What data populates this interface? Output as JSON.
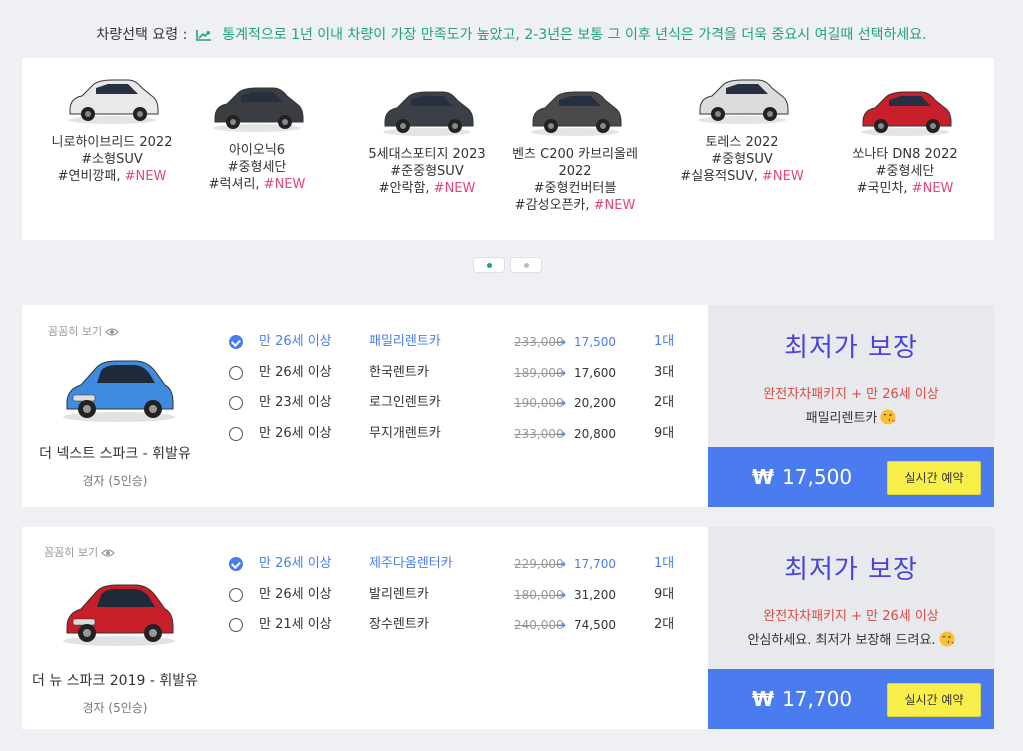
{
  "tip": {
    "label": "차량선택 요령 :",
    "icon": "trending-up-icon",
    "text": "통계적으로 1년 이내 차량이 가장 만족도가 높았고, 2-3년은 보통 그 이후 년식은 가격을 더욱 중요시 여길때 선택하세요."
  },
  "carousel": {
    "cars": [
      {
        "name": "니로하이브리드 2022",
        "segment": "#소형SUV",
        "tag": "#연비깡패,",
        "new": "#NEW",
        "color": "#e9e9e9"
      },
      {
        "name": "아이오닉6",
        "segment": "#중형세단",
        "tag": "#럭셔리,",
        "new": "#NEW",
        "color": "#3a3d42"
      },
      {
        "name": "5세대스포티지 2023",
        "segment": "#준중형SUV",
        "tag": "#안락함,",
        "new": "#NEW",
        "color": "#3b3f48"
      },
      {
        "name": "벤츠 C200 카브리올레 2022",
        "segment": "#중형컨버터블",
        "tag": "#감성오픈카,",
        "new": "#NEW",
        "color": "#4a4a4a"
      },
      {
        "name": "토레스 2022",
        "segment": "#중형SUV",
        "tag": "#실용적SUV,",
        "new": "#NEW",
        "color": "#dcdcdc"
      },
      {
        "name": "쏘나타 DN8 2022",
        "segment": "#중형세단",
        "tag": "#국민차,",
        "new": "#NEW",
        "color": "#c8202a"
      }
    ],
    "page_count": 2,
    "active_page": 1
  },
  "listings": [
    {
      "peek_label": "꼼꼼히 보기",
      "title": "더 넥스트 스파크 - 휘발유",
      "subtitle": "경자 (5인승)",
      "car_color": "#3f8be0",
      "offers": [
        {
          "age": "만 26세 이상",
          "company": "패밀리렌트카",
          "old_price": "233,000",
          "new_price": "17,500",
          "count": "1대",
          "selected": true
        },
        {
          "age": "만 26세 이상",
          "company": "한국렌트카",
          "old_price": "189,000",
          "new_price": "17,600",
          "count": "3대",
          "selected": false
        },
        {
          "age": "만 23세 이상",
          "company": "로그인렌트카",
          "old_price": "190,000",
          "new_price": "20,200",
          "count": "2대",
          "selected": false
        },
        {
          "age": "만 26세 이상",
          "company": "무지개렌트카",
          "old_price": "233,000",
          "new_price": "20,800",
          "count": "9대",
          "selected": false
        }
      ],
      "best_label": "최저가 보장",
      "package": "완전자차패키지 + 만 26세 이상",
      "message": "패밀리렌트카",
      "price": "17,500",
      "currency": "₩",
      "reserve_label": "실시간 예약"
    },
    {
      "peek_label": "꼼꼼히 보기",
      "title": "더 뉴 스파크 2019 - 휘발유",
      "subtitle": "경자 (5인승)",
      "car_color": "#c81e2a",
      "offers": [
        {
          "age": "만 26세 이상",
          "company": "제주다움렌터카",
          "old_price": "229,000",
          "new_price": "17,700",
          "count": "1대",
          "selected": true
        },
        {
          "age": "만 26세 이상",
          "company": "발리렌트카",
          "old_price": "180,000",
          "new_price": "31,200",
          "count": "9대",
          "selected": false
        },
        {
          "age": "만 21세 이상",
          "company": "장수렌트카",
          "old_price": "240,000",
          "new_price": "74,500",
          "count": "2대",
          "selected": false
        }
      ],
      "best_label": "최저가 보장",
      "package": "완전자차패키지 + 만 26세 이상",
      "message": "안심하세요. 최저가 보장해 드려요.",
      "price": "17,700",
      "currency": "₩",
      "reserve_label": "실시간 예약"
    }
  ]
}
